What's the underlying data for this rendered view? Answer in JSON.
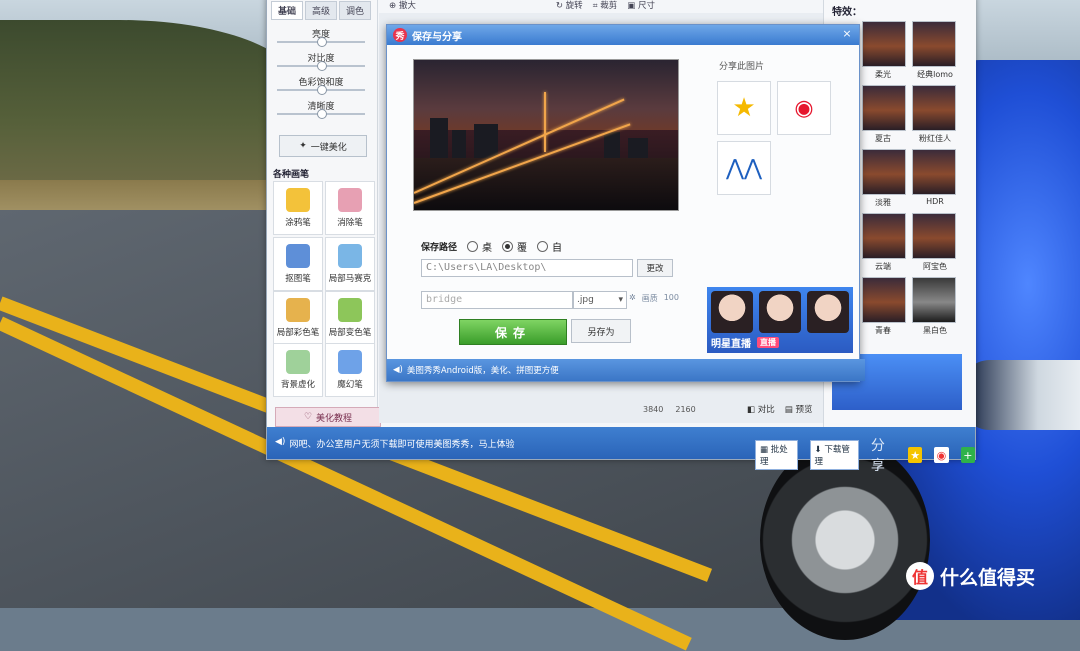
{
  "app": {
    "tabs": [
      "基础",
      "高级",
      "调色"
    ],
    "sliders": [
      "亮度",
      "对比度",
      "色彩饱和度",
      "清晰度"
    ],
    "beautify_button": "一键美化",
    "brush_section_title": "各种画笔",
    "tools": [
      {
        "label": "涂鸦笔",
        "color": "#f3c23a"
      },
      {
        "label": "消除笔",
        "color": "#e7a0b3"
      },
      {
        "label": "抠图笔",
        "color": "#5e8fd8"
      },
      {
        "label": "局部马赛克",
        "color": "#7ab6e6"
      },
      {
        "label": "局部彩色笔",
        "color": "#e6b24d"
      },
      {
        "label": "局部变色笔",
        "color": "#8dc65a"
      },
      {
        "label": "背景虚化",
        "color": "#9fd19a"
      },
      {
        "label": "魔幻笔",
        "color": "#6ea2e8"
      }
    ],
    "tutorial_button": "美化教程",
    "toolbar": [
      "撤大",
      "旋转",
      "裁剪",
      "尺寸"
    ],
    "effects_title": "特效：",
    "effects": [
      "柔光",
      "经典lomo",
      "夏古",
      "粉红佳人",
      "淡雅",
      "HDR",
      "云端",
      "阿宝色",
      "青春",
      "黑白色"
    ],
    "image_size": {
      "w": "3840",
      "h": "2160"
    },
    "compare_label": "对比",
    "preview_label": "预览",
    "bottom_message": "网吧、办公室用户无须下载即可使用美图秀秀，马上体验",
    "batch_label": "批处理",
    "download_label": "下载管理",
    "share_text": "分享"
  },
  "dialog": {
    "title": "保存与分享",
    "close": "×",
    "path_label": "保存路径",
    "path_options": [
      {
        "label": "桌",
        "checked": false
      },
      {
        "label": "覆",
        "checked": true
      },
      {
        "label": "自",
        "checked": false
      }
    ],
    "path_value": "C:\\Users\\LA\\Desktop\\",
    "change_button": "更改",
    "filename_value": "bridge",
    "extension_value": ".jpg",
    "quality_label": "画质",
    "quality_value": "100",
    "save_button": "保存",
    "save_as_button": "另存为",
    "share_title": "分享此图片",
    "share_icons": [
      "qzone-icon",
      "weibo-icon",
      "renren-icon"
    ],
    "ad_label": "明星直播",
    "ad_live": "直播",
    "bottom_tip": "美图秀秀Android版，美化、拼图更方便"
  },
  "watermark": "什么值得买"
}
